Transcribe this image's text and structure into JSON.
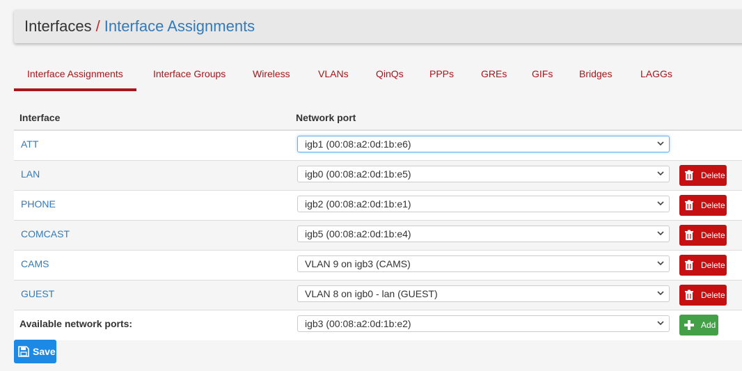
{
  "breadcrumb": {
    "root": "Interfaces",
    "separator": "/",
    "current": "Interface Assignments"
  },
  "tabs": [
    "Interface Assignments",
    "Interface Groups",
    "Wireless",
    "VLANs",
    "QinQs",
    "PPPs",
    "GREs",
    "GIFs",
    "Bridges",
    "LAGGs"
  ],
  "active_tab": "Interface Assignments",
  "table": {
    "headers": {
      "interface": "Interface",
      "port": "Network port"
    },
    "rows": [
      {
        "interface": "ATT",
        "port": "igb1 (00:08:a2:0d:1b:e6)",
        "delete": ""
      },
      {
        "interface": "LAN",
        "port": "igb0 (00:08:a2:0d:1b:e5)",
        "delete": "Delete"
      },
      {
        "interface": "PHONE",
        "port": "igb2 (00:08:a2:0d:1b:e1)",
        "delete": "Delete"
      },
      {
        "interface": "COMCAST",
        "port": "igb5 (00:08:a2:0d:1b:e4)",
        "delete": "Delete"
      },
      {
        "interface": "CAMS",
        "port": "VLAN 9 on igb3 (CAMS)",
        "delete": "Delete"
      },
      {
        "interface": "GUEST",
        "port": "VLAN 8 on igb0 - lan (GUEST)",
        "delete": "Delete"
      }
    ],
    "available": {
      "label": "Available network ports:",
      "port": "igb3 (00:08:a2:0d:1b:e2)",
      "add": "Add"
    }
  },
  "save_label": "Save",
  "icons": {
    "delete": "trash-icon",
    "add": "plus-icon",
    "save": "floppy-disk-icon",
    "select": "chevron-down-icon"
  },
  "colors": {
    "accent_red": "#a6161a",
    "link_blue": "#337ab7",
    "delete_red": "#c41010",
    "add_green": "#43a047",
    "save_blue": "#1e88e5"
  }
}
